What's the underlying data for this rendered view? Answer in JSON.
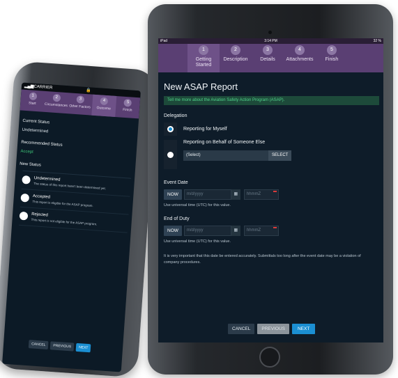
{
  "phone": {
    "carrier": "CARRIER",
    "steps": [
      {
        "num": "1",
        "label": "Start"
      },
      {
        "num": "2",
        "label": "Circumstances"
      },
      {
        "num": "3",
        "label": "Other Factors"
      },
      {
        "num": "4",
        "label": "Outcome"
      },
      {
        "num": "5",
        "label": "Finish"
      }
    ],
    "current_status_label": "Current Status",
    "current_status_value": "Undetermined",
    "recommended_status_label": "Recommended Status",
    "recommended_status_value": "Accept",
    "new_status_label": "New Status",
    "options": [
      {
        "title": "Undetermined",
        "desc": "The status of this report hasn't been determined yet."
      },
      {
        "title": "Accepted",
        "desc": "This report is eligible for the ASAP program."
      },
      {
        "title": "Rejected",
        "desc": "This report is not eligible for the ASAP program."
      }
    ],
    "buttons": {
      "cancel": "CANCEL",
      "previous": "PREVIOUS",
      "next": "NEXT"
    }
  },
  "tablet": {
    "status": {
      "left": "iPad",
      "time": "3:14 PM",
      "battery": "32 %"
    },
    "steps": [
      {
        "num": "1",
        "label": "Getting Started"
      },
      {
        "num": "2",
        "label": "Description"
      },
      {
        "num": "3",
        "label": "Details"
      },
      {
        "num": "4",
        "label": "Attachments"
      },
      {
        "num": "5",
        "label": "Finish"
      }
    ],
    "title": "New ASAP Report",
    "info_link": "Tell me more about the Aviation Safety Action Program (ASAP).",
    "delegation_label": "Delegation",
    "option_self": "Reporting for Myself",
    "option_other": "Reporting on Behalf of Someone Else",
    "select_value": "(Select)",
    "select_button": "SELECT",
    "event_date_label": "Event Date",
    "end_duty_label": "End of Duty",
    "now_label": "NOW",
    "date_placeholder": "m/d/yyyy",
    "time_placeholder": "hhmmZ",
    "utc_hint": "Use universal time (UTC) for this value.",
    "note": "It is very important that this date be entered accurately. Submittals too long after the event date may be a violation of company procedures.",
    "buttons": {
      "cancel": "CANCEL",
      "previous": "PREVIOUS",
      "next": "NEXT"
    }
  }
}
